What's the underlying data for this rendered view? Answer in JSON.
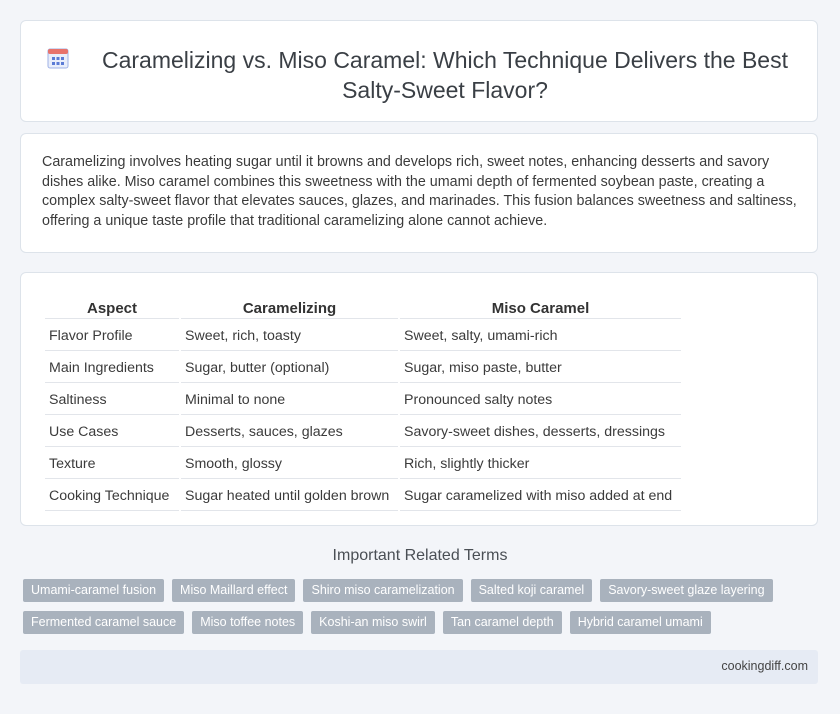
{
  "header": {
    "title": "Caramelizing vs. Miso Caramel: Which Technique Delivers the Best Salty-Sweet Flavor?",
    "icon": "calendar-grid-icon"
  },
  "intro": {
    "text": "Caramelizing involves heating sugar until it browns and develops rich, sweet notes, enhancing desserts and savory dishes alike. Miso caramel combines this sweetness with the umami depth of fermented soybean paste, creating a complex salty-sweet flavor that elevates sauces, glazes, and marinades. This fusion balances sweetness and saltiness, offering a unique taste profile that traditional caramelizing alone cannot achieve."
  },
  "table": {
    "headers": [
      "Aspect",
      "Caramelizing",
      "Miso Caramel"
    ],
    "rows": [
      [
        "Flavor Profile",
        "Sweet, rich, toasty",
        "Sweet, salty, umami-rich"
      ],
      [
        "Main Ingredients",
        "Sugar, butter (optional)",
        "Sugar, miso paste, butter"
      ],
      [
        "Saltiness",
        "Minimal to none",
        "Pronounced salty notes"
      ],
      [
        "Use Cases",
        "Desserts, sauces, glazes",
        "Savory-sweet dishes, desserts, dressings"
      ],
      [
        "Texture",
        "Smooth, glossy",
        "Rich, slightly thicker"
      ],
      [
        "Cooking Technique",
        "Sugar heated until golden brown",
        "Sugar caramelized with miso added at end"
      ]
    ]
  },
  "terms": {
    "heading": "Important Related Terms",
    "items": [
      "Umami-caramel fusion",
      "Miso Maillard effect",
      "Shiro miso caramelization",
      "Salted koji caramel",
      "Savory-sweet glaze layering",
      "Fermented caramel sauce",
      "Miso toffee notes",
      "Koshi-an miso swirl",
      "Tan caramel depth",
      "Hybrid caramel umami"
    ]
  },
  "footer": {
    "site": "cookingdiff.com"
  },
  "colors": {
    "background": "#f3f5f9",
    "tag_bg": "#a9b2bd",
    "footer_bg": "#e6ebf4",
    "icon_blue": "#5b7bd5",
    "icon_red": "#e8736c"
  }
}
